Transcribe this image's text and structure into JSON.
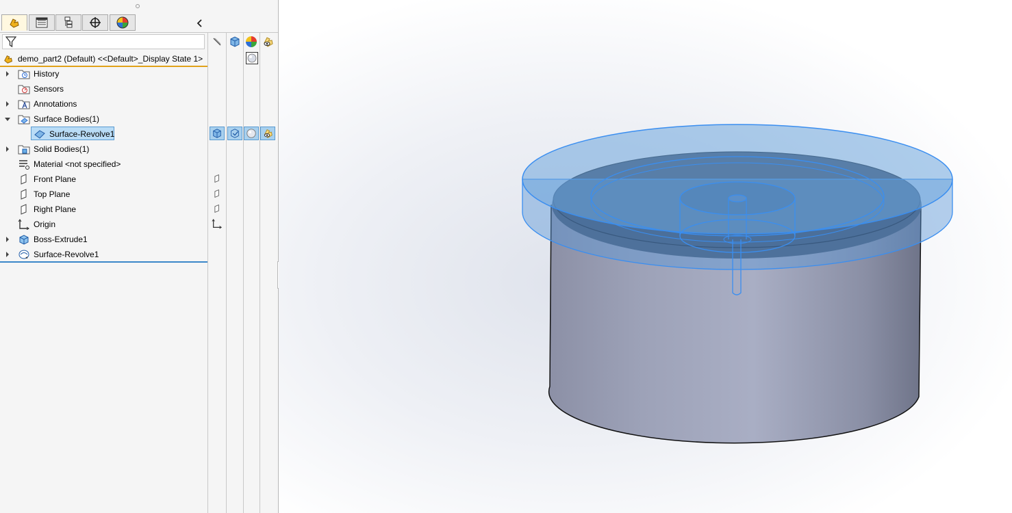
{
  "feature_tree": {
    "root_label": "demo_part2 (Default) <<Default>_Display State 1>",
    "filter_placeholder": "",
    "items": [
      {
        "label": "History",
        "expandable": true,
        "icon": "history-folder-icon"
      },
      {
        "label": "Sensors",
        "expandable": false,
        "icon": "sensors-folder-icon"
      },
      {
        "label": "Annotations",
        "expandable": true,
        "icon": "annotations-folder-icon"
      },
      {
        "label": "Surface Bodies(1)",
        "expandable": true,
        "expanded": true,
        "icon": "surface-bodies-folder-icon"
      },
      {
        "label": "Surface-Revolve1",
        "child": true,
        "selected": true,
        "icon": "surface-body-icon"
      },
      {
        "label": "Solid Bodies(1)",
        "expandable": true,
        "icon": "solid-bodies-folder-icon"
      },
      {
        "label": "Material <not specified>",
        "expandable": false,
        "icon": "material-icon"
      },
      {
        "label": "Front Plane",
        "expandable": false,
        "icon": "plane-icon"
      },
      {
        "label": "Top Plane",
        "expandable": false,
        "icon": "plane-icon"
      },
      {
        "label": "Right Plane",
        "expandable": false,
        "icon": "plane-icon"
      },
      {
        "label": "Origin",
        "expandable": false,
        "icon": "origin-icon"
      },
      {
        "label": "Boss-Extrude1",
        "expandable": true,
        "icon": "boss-extrude-icon"
      },
      {
        "label": "Surface-Revolve1",
        "expandable": true,
        "icon": "surface-revolve-icon"
      }
    ]
  },
  "tabs": [
    {
      "name": "featuremanager-tab",
      "icon": "featuremanager-icon"
    },
    {
      "name": "propertymanager-tab",
      "icon": "propertymanager-icon"
    },
    {
      "name": "configurationmanager-tab",
      "icon": "configurationmanager-icon"
    },
    {
      "name": "dimxpertmanager-tab",
      "icon": "dimxpert-icon"
    },
    {
      "name": "displaymanager-tab",
      "icon": "displaymanager-icon"
    }
  ],
  "colors": {
    "accent_orange": "#e0a21a",
    "selection_blue": "#b9dcf6",
    "tree_divider_blue": "#3a86c8",
    "model_transparent_blue": "#5b97d6",
    "model_gray": "#9aa0b4"
  }
}
